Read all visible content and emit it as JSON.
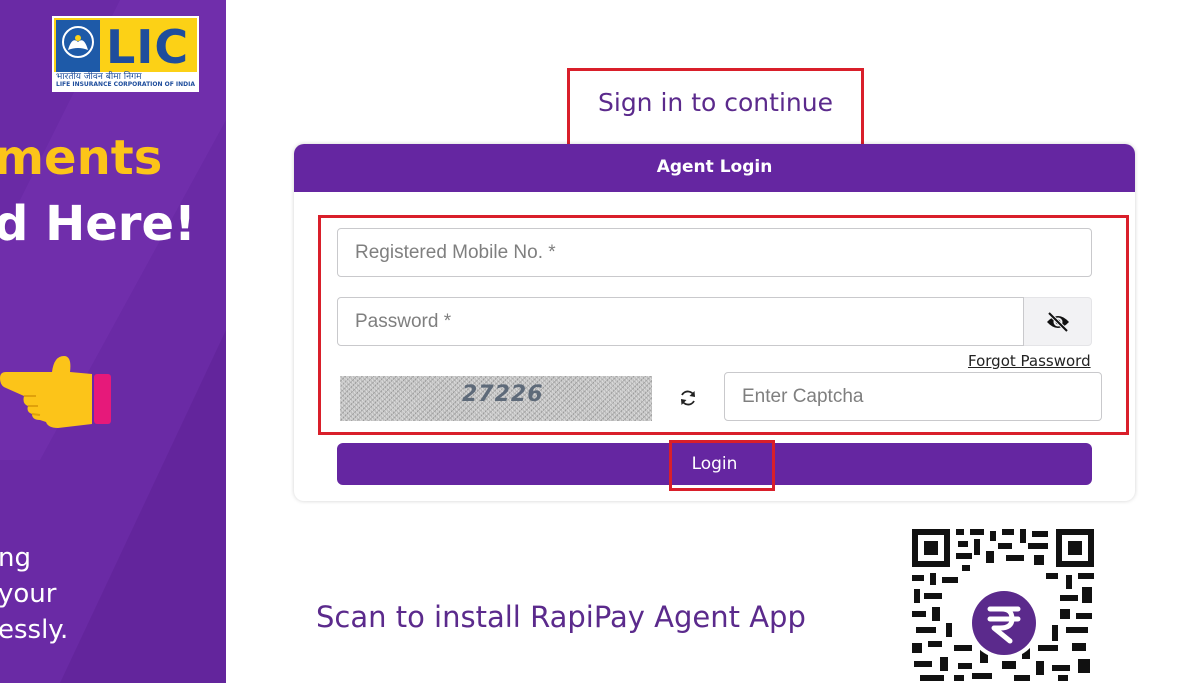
{
  "brand": {
    "logo_text": "LIC",
    "logo_hindi": "भारतीय जीवन बीमा निगम",
    "logo_english": "LIFE INSURANCE CORPORATION OF INDIA"
  },
  "promo": {
    "line1": "ments",
    "line2": "d Here!",
    "small_lines": [
      "ng",
      "your",
      "essly."
    ]
  },
  "signin": {
    "title": "Sign in to continue"
  },
  "card": {
    "header": "Agent Login",
    "mobile_placeholder": "Registered Mobile No. *",
    "password_placeholder": "Password *",
    "forgot_password": "Forgot Password",
    "captcha_value": "27226",
    "captcha_placeholder": "Enter Captcha",
    "login_label": "Login"
  },
  "app": {
    "scan_text": "Scan to install RapiPay Agent App",
    "qr_center_icon": "rupee-icon"
  },
  "colors": {
    "brand_purple": "#6526a1",
    "highlight_red": "#d91f2a",
    "promo_yellow": "#fcc419"
  },
  "icons": {
    "password_toggle": "eye-slash-icon",
    "captcha_refresh": "refresh-icon",
    "pointer": "pointing-hand-icon"
  }
}
